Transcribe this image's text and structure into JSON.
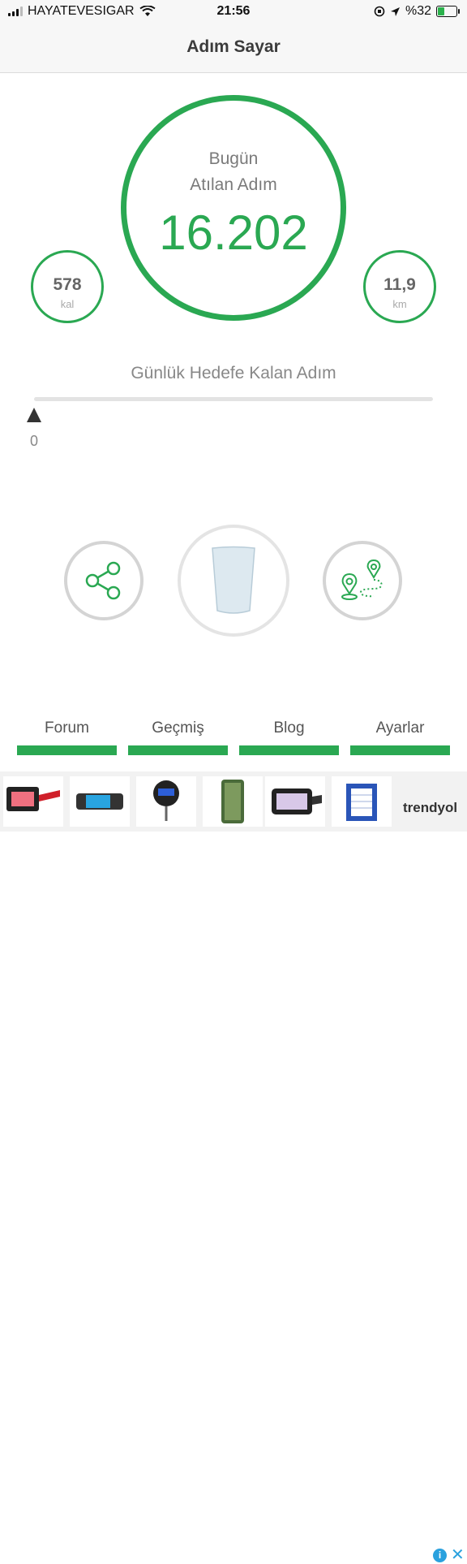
{
  "status_bar": {
    "carrier": "HAYATEVESIGAR",
    "time": "21:56",
    "battery": "%32"
  },
  "nav": {
    "title": "Adım Sayar"
  },
  "steps": {
    "label_line1": "Bugün",
    "label_line2": "Atılan Adım",
    "value": "16.202"
  },
  "calories": {
    "value": "578",
    "unit": "kal"
  },
  "distance": {
    "value": "11,9",
    "unit": "km"
  },
  "goal": {
    "label": "Günlük Hedefe Kalan Adım",
    "value": "0",
    "progress": 0
  },
  "tabs": [
    {
      "label": "Forum"
    },
    {
      "label": "Geçmiş"
    },
    {
      "label": "Blog"
    },
    {
      "label": "Ayarlar"
    }
  ],
  "ad": {
    "brand": "trendyol",
    "items": [
      "running-belt",
      "phone-armband",
      "luggage-scale",
      "phone-case",
      "running-belt-2",
      "vacuum-filter"
    ]
  },
  "colors": {
    "accent": "#2aa852",
    "nav_background": "#f7f7f7",
    "ad_info": "#2aa1de"
  }
}
